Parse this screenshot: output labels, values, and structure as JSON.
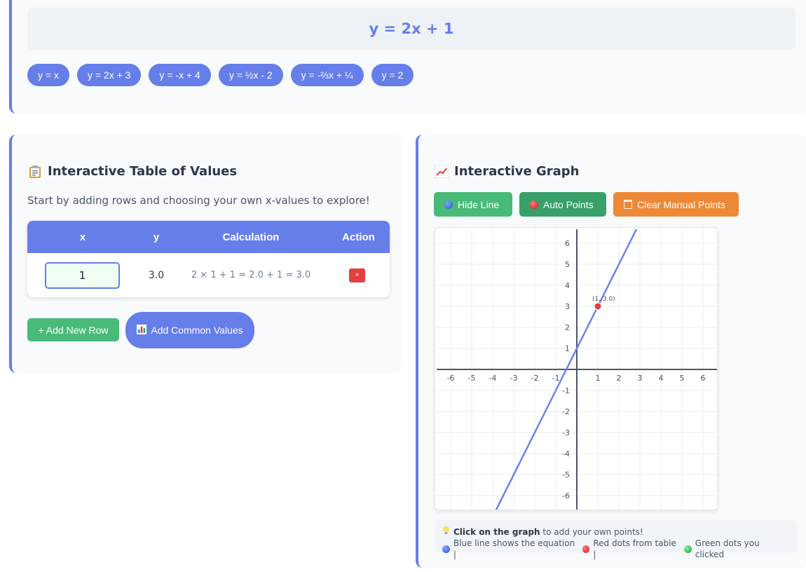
{
  "equation": {
    "display": "y = 2x + 1",
    "slope": 2,
    "intercept": 1
  },
  "presets": [
    "y = x",
    "y = 2x + 3",
    "y = -x + 4",
    "y = ½x - 2",
    "y = -⅔x + ¼",
    "y = 2"
  ],
  "table_section": {
    "title": "Interactive Table of Values",
    "icon": "clipboard-icon",
    "description": "Start by adding rows and choosing your own x-values to explore!",
    "headers": [
      "x",
      "y",
      "Calculation",
      "Action"
    ],
    "rows": [
      {
        "x": "1",
        "y": "3.0",
        "calculation": "2 × 1 + 1 = 2.0 + 1 = 3.0",
        "action": "×"
      }
    ],
    "add_row_label": "+ Add New Row",
    "add_common_label": "Add Common Values"
  },
  "graph_section": {
    "title": "Interactive Graph",
    "icon": "chart-icon",
    "buttons": {
      "hide_line": "Hide Line",
      "auto_points": "Auto Points",
      "clear": "Clear Manual Points"
    },
    "hint": {
      "bold": "Click on the graph",
      "rest": " to add your own points!",
      "legend_blue": "Blue line shows the equation |",
      "legend_red": "Red dots from table |",
      "legend_green": "Green dots you clicked"
    }
  },
  "colors": {
    "accent": "#667eea",
    "line": "#6b83e8",
    "point": "#e53e3e",
    "grid": "#e9ecef",
    "axis": "#4a5568"
  },
  "chart_data": {
    "type": "line",
    "xlim": [
      -6.5,
      6.5
    ],
    "ylim": [
      -6.5,
      6.5
    ],
    "x_ticks": [
      -6,
      -5,
      -4,
      -3,
      -2,
      -1,
      1,
      2,
      3,
      4,
      5,
      6
    ],
    "y_ticks": [
      -6,
      -5,
      -4,
      -3,
      -2,
      -1,
      1,
      2,
      3,
      4,
      5,
      6
    ],
    "grid": true,
    "series": [
      {
        "slope": 2,
        "intercept": 1
      }
    ],
    "points": [
      {
        "x": 1,
        "y": 3,
        "label": "(1, 3.0)"
      }
    ]
  }
}
